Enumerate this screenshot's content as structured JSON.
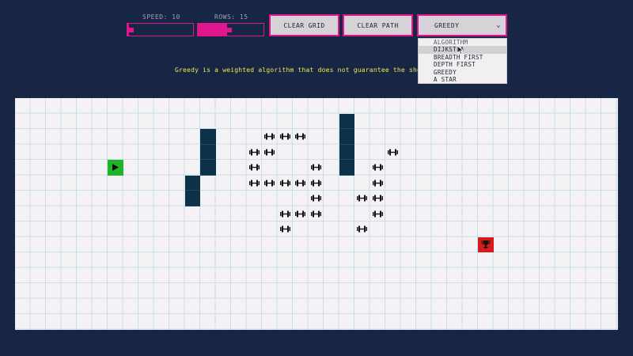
{
  "controls": {
    "speed_label": "SPEED: 10",
    "speed_value": 10,
    "rows_label": "ROWS: 15",
    "rows_value": 15,
    "clear_grid_label": "CLEAR GRID",
    "clear_path_label": "CLEAR PATH",
    "algorithm_selected": "GREEDY"
  },
  "dropdown": {
    "options": [
      "ALGORITHM",
      "DIJKSTRA",
      "BREADTH FIRST",
      "DEPTH FIRST",
      "GREEDY",
      "A STAR"
    ],
    "highlighted_index": 1
  },
  "message": "Greedy is a weighted algorithm that does not guarantee the shortest path",
  "grid": {
    "rows": 15,
    "cols": 39,
    "start": [
      4,
      6
    ],
    "target": [
      9,
      30
    ],
    "walls": [
      [
        1,
        21
      ],
      [
        2,
        12
      ],
      [
        2,
        21
      ],
      [
        3,
        12
      ],
      [
        3,
        21
      ],
      [
        4,
        12
      ],
      [
        4,
        21
      ],
      [
        5,
        11
      ],
      [
        6,
        11
      ]
    ],
    "weights": [
      [
        2,
        16
      ],
      [
        2,
        17
      ],
      [
        2,
        18
      ],
      [
        3,
        15
      ],
      [
        3,
        16
      ],
      [
        3,
        24
      ],
      [
        4,
        15
      ],
      [
        4,
        19
      ],
      [
        4,
        23
      ],
      [
        5,
        15
      ],
      [
        5,
        16
      ],
      [
        5,
        17
      ],
      [
        5,
        18
      ],
      [
        5,
        19
      ],
      [
        5,
        23
      ],
      [
        6,
        19
      ],
      [
        6,
        22
      ],
      [
        6,
        23
      ],
      [
        7,
        17
      ],
      [
        7,
        18
      ],
      [
        7,
        19
      ],
      [
        7,
        23
      ],
      [
        8,
        17
      ],
      [
        8,
        22
      ]
    ]
  },
  "colors": {
    "background": "#172645",
    "accent": "#e0168c",
    "wall": "#0d3248",
    "start": "#1fb32c",
    "target": "#d51b1b",
    "message": "#f1e84c"
  },
  "icons": {
    "start": "play-icon",
    "target": "trophy-icon",
    "weight": "dumbbell-icon"
  }
}
